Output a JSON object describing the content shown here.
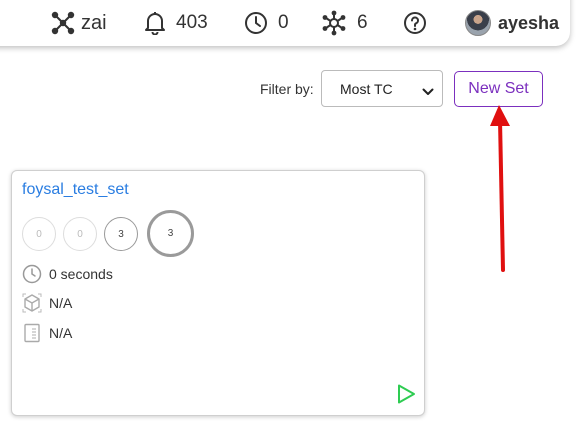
{
  "nav": {
    "brand": "zai",
    "notifications": "403",
    "pending": "0",
    "network": "6",
    "user": "ayesha"
  },
  "toolbar": {
    "filter_label": "Filter by:",
    "filter_value": "Most TC",
    "new_set_label": "New Set"
  },
  "card": {
    "title": "foysal_test_set",
    "stats": [
      "0",
      "0",
      "3",
      "3"
    ],
    "duration": "0 seconds",
    "environment": "N/A",
    "document": "N/A"
  },
  "colors": {
    "accent": "#7b2fbe",
    "link": "#2a7de1",
    "play": "#2ecc52",
    "annotation": "#e01010"
  },
  "icons": [
    "brand-network-icon",
    "bell-icon",
    "clock-icon",
    "network-icon",
    "help-icon",
    "chevron-down-icon",
    "box-icon",
    "document-icon",
    "play-icon"
  ]
}
